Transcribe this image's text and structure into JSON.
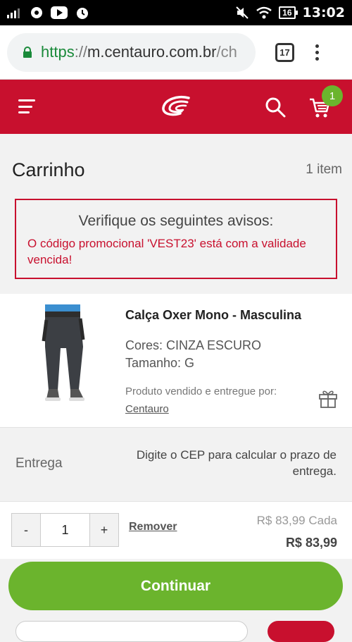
{
  "status_bar": {
    "time": "13:02",
    "battery": "16"
  },
  "browser": {
    "url_scheme": "https",
    "url_sep": "://",
    "url_host": "m.centauro.com.br",
    "url_path": "/ch",
    "tabs_count": "17"
  },
  "header": {
    "cart_badge": "1"
  },
  "cart": {
    "title": "Carrinho",
    "item_count": "1 item",
    "warning_title": "Verifique os seguintes avisos:",
    "warning_message": "O código promocional 'VEST23' está com a validade vencida!"
  },
  "product": {
    "name": "Calça Oxer Mono - Masculina",
    "color": "Cores: CINZA ESCURO",
    "size": "Tamanho: G",
    "sold_by_prefix": "Produto vendido e entregue por:",
    "seller": "Centauro"
  },
  "delivery": {
    "label": "Entrega",
    "message": "Digite o CEP para calcular o prazo de entrega."
  },
  "quantity": {
    "minus": "-",
    "value": "1",
    "plus": "+",
    "remove": "Remover",
    "unit_price": "R$ 83,99 Cada",
    "total_price": "R$ 83,99"
  },
  "footer": {
    "continue": "Continuar"
  },
  "colors": {
    "brand_red": "#c8102e",
    "accent_green": "#6bb42d"
  }
}
